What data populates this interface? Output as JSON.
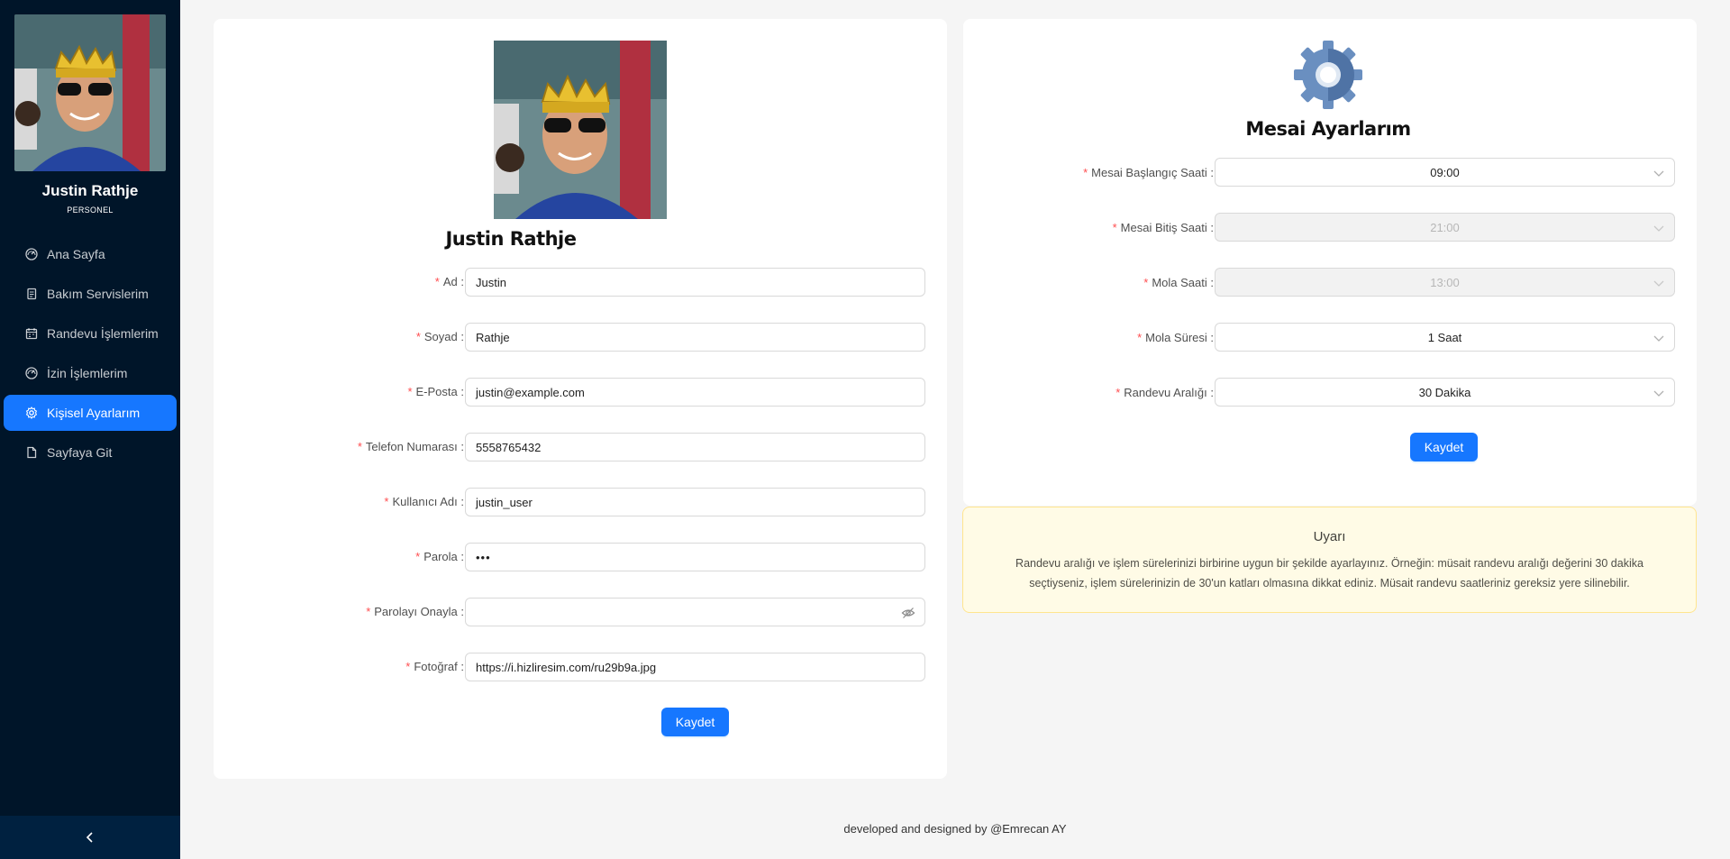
{
  "user": {
    "name": "Justin Rathje",
    "role": "PERSONEL"
  },
  "menu": [
    {
      "label": "Ana Sayfa",
      "icon": "dashboard-icon",
      "active": false
    },
    {
      "label": "Bakım Servislerim",
      "icon": "copy-icon",
      "active": false
    },
    {
      "label": "Randevu İşlemlerim",
      "icon": "calendar-icon",
      "active": false
    },
    {
      "label": "İzin İşlemlerim",
      "icon": "dashboard-icon",
      "active": false
    },
    {
      "label": "Kişisel Ayarlarım",
      "icon": "setting-icon",
      "active": true
    },
    {
      "label": "Sayfaya Git",
      "icon": "file-icon",
      "active": false
    }
  ],
  "profile_form": {
    "name": "Justin Rathje",
    "fields": {
      "ad": {
        "label": "Ad",
        "value": "Justin"
      },
      "soyad": {
        "label": "Soyad",
        "value": "Rathje"
      },
      "eposta": {
        "label": "E-Posta",
        "value": "justin@example.com"
      },
      "telefon": {
        "label": "Telefon Numarası",
        "value": "5558765432"
      },
      "kullanici": {
        "label": "Kullanıcı Adı",
        "value": "justin_user"
      },
      "parola": {
        "label": "Parola",
        "value": "•••"
      },
      "parola_onay": {
        "label": "Parolayı Onayla",
        "value": ""
      },
      "fotograf": {
        "label": "Fotoğraf",
        "value": "https://i.hizliresim.com/ru29b9a.jpg"
      }
    },
    "save_label": "Kaydet"
  },
  "work_settings": {
    "title": "Mesai Ayarlarım",
    "fields": {
      "baslangic": {
        "label": "Mesai Başlangıç Saati",
        "value": "09:00",
        "disabled": false
      },
      "bitis": {
        "label": "Mesai Bitiş Saati",
        "value": "21:00",
        "disabled": true
      },
      "mola_saati": {
        "label": "Mola Saati",
        "value": "13:00",
        "disabled": true
      },
      "mola_suresi": {
        "label": "Mola Süresi",
        "value": "1 Saat",
        "disabled": false
      },
      "randevu_araligi": {
        "label": "Randevu Aralığı",
        "value": "30 Dakika",
        "disabled": false
      }
    },
    "save_label": "Kaydet"
  },
  "warning": {
    "title": "Uyarı",
    "description": "Randevu aralığı ve işlem sürelerinizi birbirine uygun bir şekilde ayarlayınız. Örneğin: müsait randevu aralığı değerini 30 dakika seçtiyseniz, işlem sürelerinizin de 30'un katları olmasına dikkat ediniz. Müsait randevu saatleriniz gereksiz yere silinebilir."
  },
  "footer": {
    "text": "developed and designed by ",
    "author": "@Emrecan AY"
  },
  "colors": {
    "sidebar": "#001529",
    "accent": "#1677ff",
    "required": "#ff4d4f",
    "warning_bg": "#fffbe6"
  }
}
